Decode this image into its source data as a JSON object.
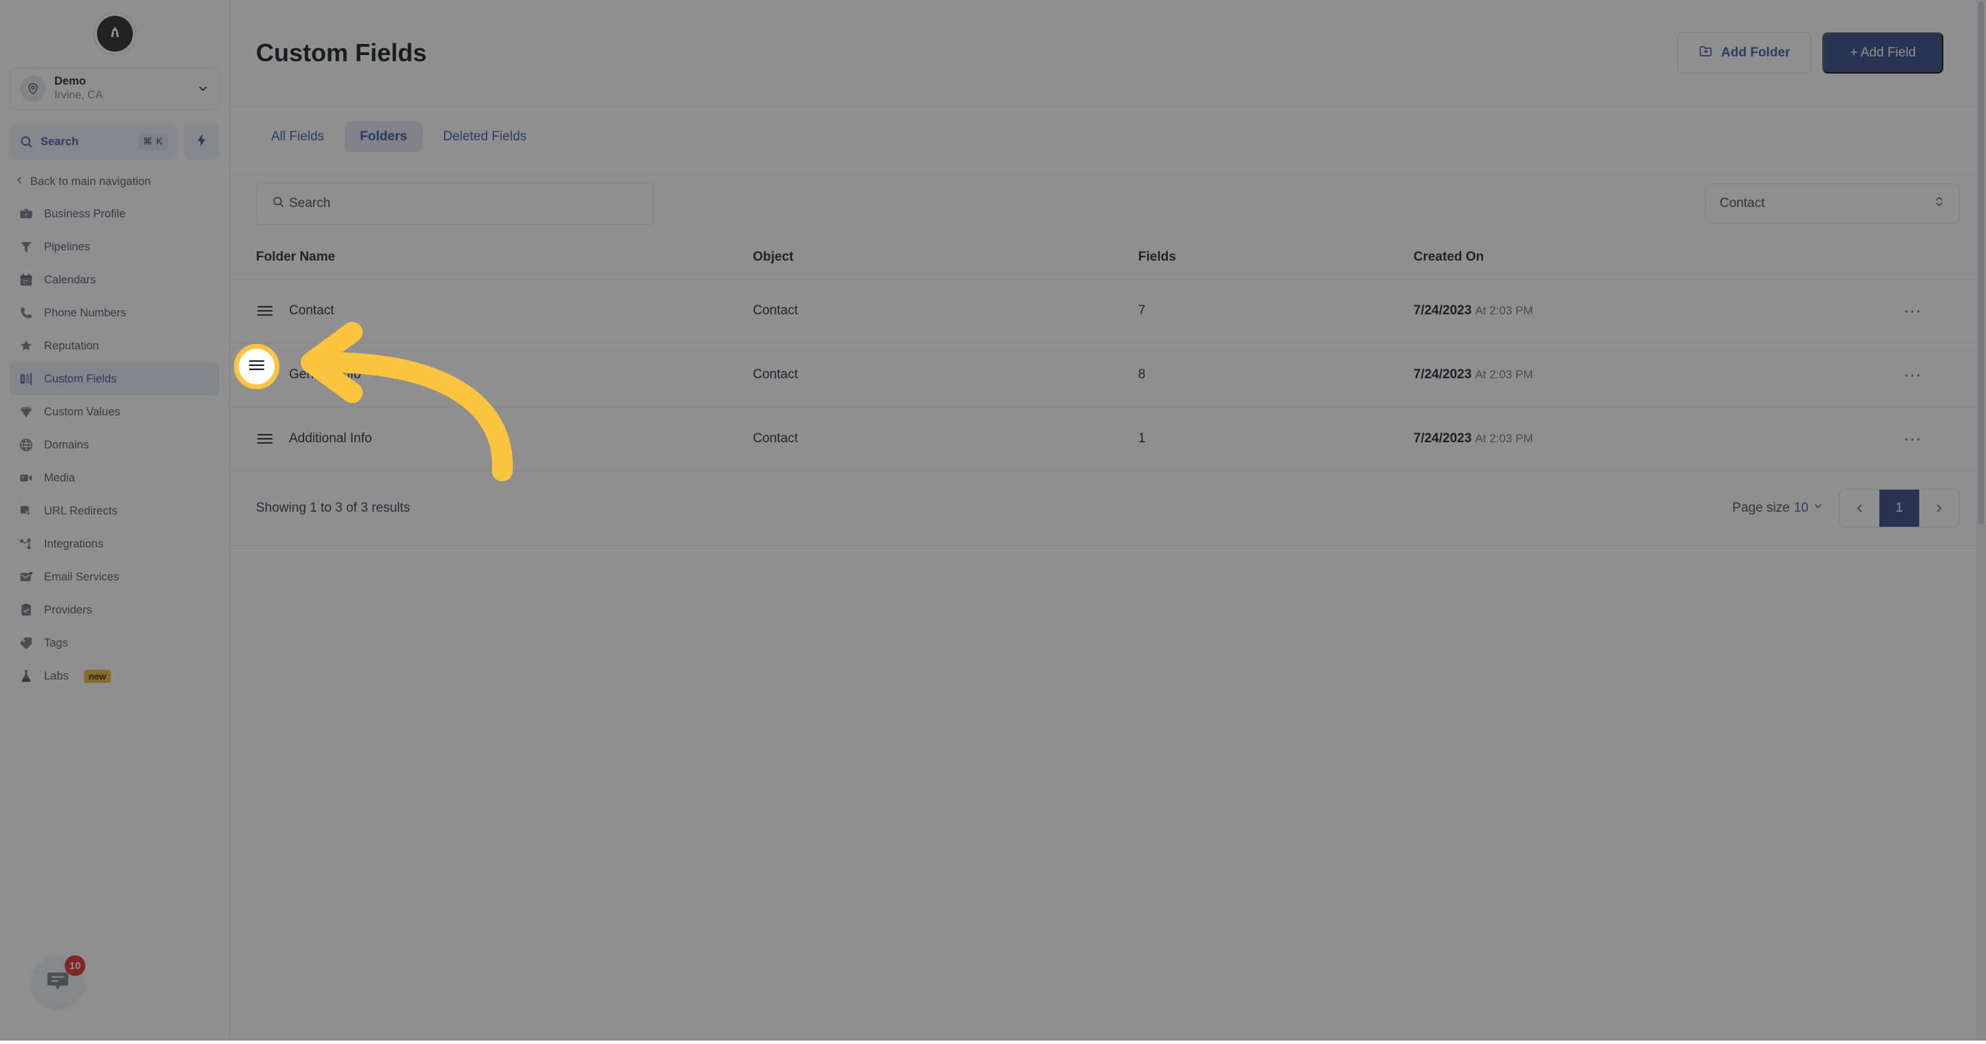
{
  "sidebar": {
    "logo_icon": "rocket-logo-icon",
    "location": {
      "name": "Demo",
      "sublabel": "Irvine, CA",
      "avatar_icon": "location-pin-icon",
      "caret_icon": "chevron-down-icon"
    },
    "search": {
      "label": "Search",
      "shortcut": "⌘ K",
      "icon": "search-icon"
    },
    "quick_action_icon": "lightning-bolt-icon",
    "back_label": "Back to main navigation",
    "back_icon": "chevron-left-icon",
    "items": [
      {
        "label": "Business Profile",
        "icon": "briefcase-icon",
        "active": false
      },
      {
        "label": "Pipelines",
        "icon": "funnel-icon",
        "active": false
      },
      {
        "label": "Calendars",
        "icon": "calendar-icon",
        "active": false
      },
      {
        "label": "Phone Numbers",
        "icon": "phone-icon",
        "active": false
      },
      {
        "label": "Reputation",
        "icon": "star-icon",
        "active": false
      },
      {
        "label": "Custom Fields",
        "icon": "custom-fields-icon",
        "active": true
      },
      {
        "label": "Custom Values",
        "icon": "gem-icon",
        "active": false
      },
      {
        "label": "Domains",
        "icon": "globe-icon",
        "active": false
      },
      {
        "label": "Media",
        "icon": "video-camera-icon",
        "active": false
      },
      {
        "label": "URL Redirects",
        "icon": "cursor-click-icon",
        "active": false
      },
      {
        "label": "Integrations",
        "icon": "nodes-icon",
        "active": false
      },
      {
        "label": "Email Services",
        "icon": "envelope-icon",
        "active": false
      },
      {
        "label": "Providers",
        "icon": "clipboard-check-icon",
        "active": false
      },
      {
        "label": "Tags",
        "icon": "tag-icon",
        "active": false
      },
      {
        "label": "Labs",
        "icon": "flask-icon",
        "active": false,
        "badge": "new"
      }
    ],
    "chat": {
      "icon": "chat-bubble-icon",
      "unread": "10"
    }
  },
  "header": {
    "title": "Custom Fields",
    "add_folder_label": "Add Folder",
    "add_folder_icon": "folder-plus-icon",
    "add_field_label": "+ Add Field"
  },
  "tabs": [
    {
      "label": "All Fields",
      "active": false
    },
    {
      "label": "Folders",
      "active": true
    },
    {
      "label": "Deleted Fields",
      "active": false
    }
  ],
  "filters": {
    "search_placeholder": "Search",
    "search_icon": "search-icon",
    "object_select_value": "Contact",
    "object_select_icon": "chevron-updown-icon"
  },
  "table": {
    "columns": [
      "Folder Name",
      "Object",
      "Fields",
      "Created On"
    ],
    "rows": [
      {
        "drag_icon": "drag-handle-icon",
        "folder_name": "Contact",
        "object": "Contact",
        "fields": "7",
        "created_date": "7/24/2023",
        "created_time": "At 2:03 PM",
        "menu_icon": "ellipsis-icon"
      },
      {
        "drag_icon": "drag-handle-icon",
        "folder_name": "General Info",
        "object": "Contact",
        "fields": "8",
        "created_date": "7/24/2023",
        "created_time": "At 2:03 PM",
        "menu_icon": "ellipsis-icon"
      },
      {
        "drag_icon": "drag-handle-icon",
        "folder_name": "Additional Info",
        "object": "Contact",
        "fields": "1",
        "created_date": "7/24/2023",
        "created_time": "At 2:03 PM",
        "menu_icon": "ellipsis-icon"
      }
    ]
  },
  "footer": {
    "showing_text": "Showing 1 to 3 of 3 results",
    "page_size_label": "Page size",
    "page_size_value": "10",
    "page_size_icon": "chevron-down-icon",
    "prev_icon": "chevron-left-icon",
    "next_icon": "chevron-right-icon",
    "current_page": "1"
  },
  "annotation": {
    "highlight_color": "#fbc53f",
    "highlight_target": "drag-handle-row-general-info",
    "arrow_icon": "curved-arrow-icon"
  },
  "colors": {
    "primary": "#2a4287",
    "link": "#3553a5",
    "active_tab_bg": "#e4e7f4",
    "badge_new": "#efb62c",
    "unread_badge": "#e02424",
    "highlight": "#fbc53f"
  }
}
